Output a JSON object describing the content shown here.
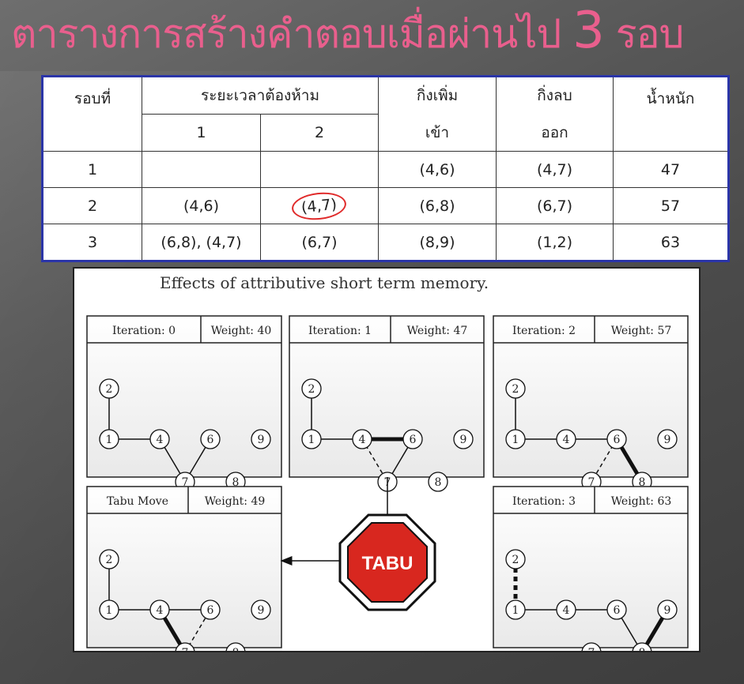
{
  "title": {
    "main": "ตารางการสร้างคำตอบเมื่อผ่านไป",
    "number": "3",
    "suffix": "รอบ"
  },
  "table": {
    "headers": {
      "round": "รอบที่",
      "tabu_period": "ระยะเวลาต้องห้าม",
      "sub1": "1",
      "sub2": "2",
      "add_line1": "กิ่งเพิ่ม",
      "add_line2": "เข้า",
      "remove_line1": "กิ่งลบ",
      "remove_line2": "ออก",
      "weight": "น้ำหนัก"
    },
    "rows": [
      {
        "round": "1",
        "t1": "",
        "t2": "",
        "add": "(4,6)",
        "remove": "(4,7)",
        "weight": "47"
      },
      {
        "round": "2",
        "t1": "(4,6)",
        "t2": "(4,7)",
        "add": "(6,8)",
        "remove": "(6,7)",
        "weight": "57"
      },
      {
        "round": "3",
        "t1": "(6,8), (4,7)",
        "t2": "(6,7)",
        "add": "(8,9)",
        "remove": "(1,2)",
        "weight": "63"
      }
    ]
  },
  "figure": {
    "title": "Effects of attributive short term memory.",
    "stop_sign": "TABU",
    "panels": [
      {
        "left": "Iteration: 0",
        "right": "Weight: 40"
      },
      {
        "left": "Iteration: 1",
        "right": "Weight: 47"
      },
      {
        "left": "Iteration: 2",
        "right": "Weight: 57"
      },
      {
        "left": "Tabu Move",
        "right": "Weight: 49"
      },
      {
        "left": "Iteration: 3",
        "right": "Weight: 63"
      }
    ],
    "node_labels": [
      "1",
      "2",
      "4",
      "6",
      "7",
      "8",
      "9"
    ]
  }
}
